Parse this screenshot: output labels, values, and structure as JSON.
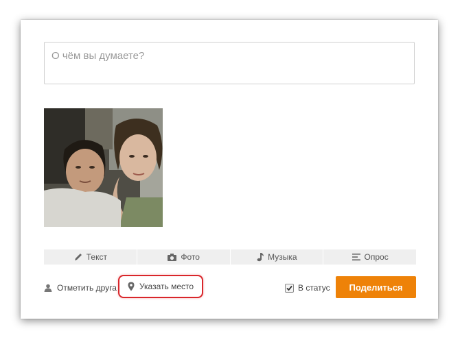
{
  "post_form": {
    "placeholder": "О чём вы думаете?"
  },
  "toolbar": {
    "items": [
      {
        "label": "Текст",
        "icon": "pencil-icon"
      },
      {
        "label": "Фото",
        "icon": "camera-icon"
      },
      {
        "label": "Музыка",
        "icon": "music-note-icon"
      },
      {
        "label": "Опрос",
        "icon": "poll-icon"
      }
    ]
  },
  "footer": {
    "tag_friend_label": "Отметить друга",
    "place_label": "Указать место",
    "status_label": "В статус",
    "status_checked": true,
    "share_label": "Поделиться"
  },
  "colors": {
    "share_button": "#ee8208",
    "highlight": "#d9262b"
  }
}
